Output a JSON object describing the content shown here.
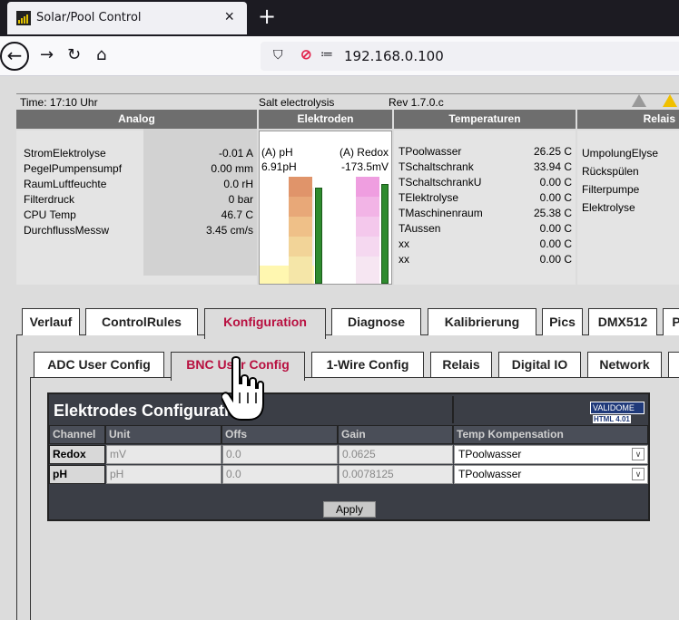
{
  "browser": {
    "tab_title": "Solar/Pool Control",
    "tab_close": "×",
    "new_tab": "+",
    "url": "192.168.0.100",
    "back_icon": "arrow-left-icon",
    "forward_icon": "arrow-right-icon",
    "reload_icon": "reload-icon",
    "home_icon": "home-icon"
  },
  "status": {
    "time": "Time: 17:10 Uhr",
    "mode": "Salt electrolysis",
    "rev": "Rev 1.7.0.c"
  },
  "sections": {
    "analog": "Analog",
    "elektroden": "Elektroden",
    "temperaturen": "Temperaturen",
    "relais": "Relais"
  },
  "analog": [
    {
      "label": "StromElektrolyse",
      "value": "-0.01 A"
    },
    {
      "label": "PegelPumpensumpf",
      "value": "0.00 mm"
    },
    {
      "label": "RaumLuftfeuchte",
      "value": "0.0 rH"
    },
    {
      "label": "Filterdruck",
      "value": "0 bar"
    },
    {
      "label": "CPU Temp",
      "value": "46.7 C"
    },
    {
      "label": "DurchflussMessw",
      "value": "3.45 cm/s"
    }
  ],
  "electrodes": {
    "ph_label": "(A) pH",
    "ph_value": "6.91pH",
    "redox_label": "(A) Redox",
    "redox_value": "-173.5mV",
    "ph_level": 0.95,
    "redox_level": 0.98
  },
  "temperatures": [
    {
      "label": "TPoolwasser",
      "value": "26.25 C"
    },
    {
      "label": "TSchaltschrank",
      "value": "33.94 C"
    },
    {
      "label": "TSchaltschrankU",
      "value": "0.00 C"
    },
    {
      "label": "TElektrolyse",
      "value": "0.00 C"
    },
    {
      "label": "TMaschinenraum",
      "value": "25.38 C"
    },
    {
      "label": "TAussen",
      "value": "0.00 C"
    },
    {
      "label": "xx",
      "value": "0.00 C"
    },
    {
      "label": "xx",
      "value": "0.00 C"
    }
  ],
  "relais": [
    "UmpolungElyse",
    "Rückspülen",
    "Filterpumpe",
    "Elektrolyse"
  ],
  "main_tabs": [
    "Verlauf",
    "ControlRules",
    "Konfiguration",
    "Diagnose",
    "Kalibrierung",
    "Pics",
    "DMX512",
    "P"
  ],
  "sub_tabs": [
    "ADC User Config",
    "BNC User Config",
    "1-Wire Config",
    "Relais",
    "Digital IO",
    "Network"
  ],
  "config": {
    "title": "Elektrodes Configuration",
    "validator_text": "VALIDOME",
    "validator_badge": "HTML 4.01",
    "headers": [
      "Channel",
      "Unit",
      "Offs",
      "Gain",
      "Temp Kompensation"
    ],
    "rows": [
      {
        "channel": "Redox",
        "unit": "mV",
        "offs": "0.0",
        "gain": "0.0625",
        "temp": "TPoolwasser"
      },
      {
        "channel": "pH",
        "unit": "pH",
        "offs": "0.0",
        "gain": "0.0078125",
        "temp": "TPoolwasser"
      }
    ],
    "apply": "Apply"
  },
  "colors": {
    "active_tab_text": "#b81040",
    "section_header": "#6e6e6e",
    "table_bg": "#3b3e46"
  }
}
